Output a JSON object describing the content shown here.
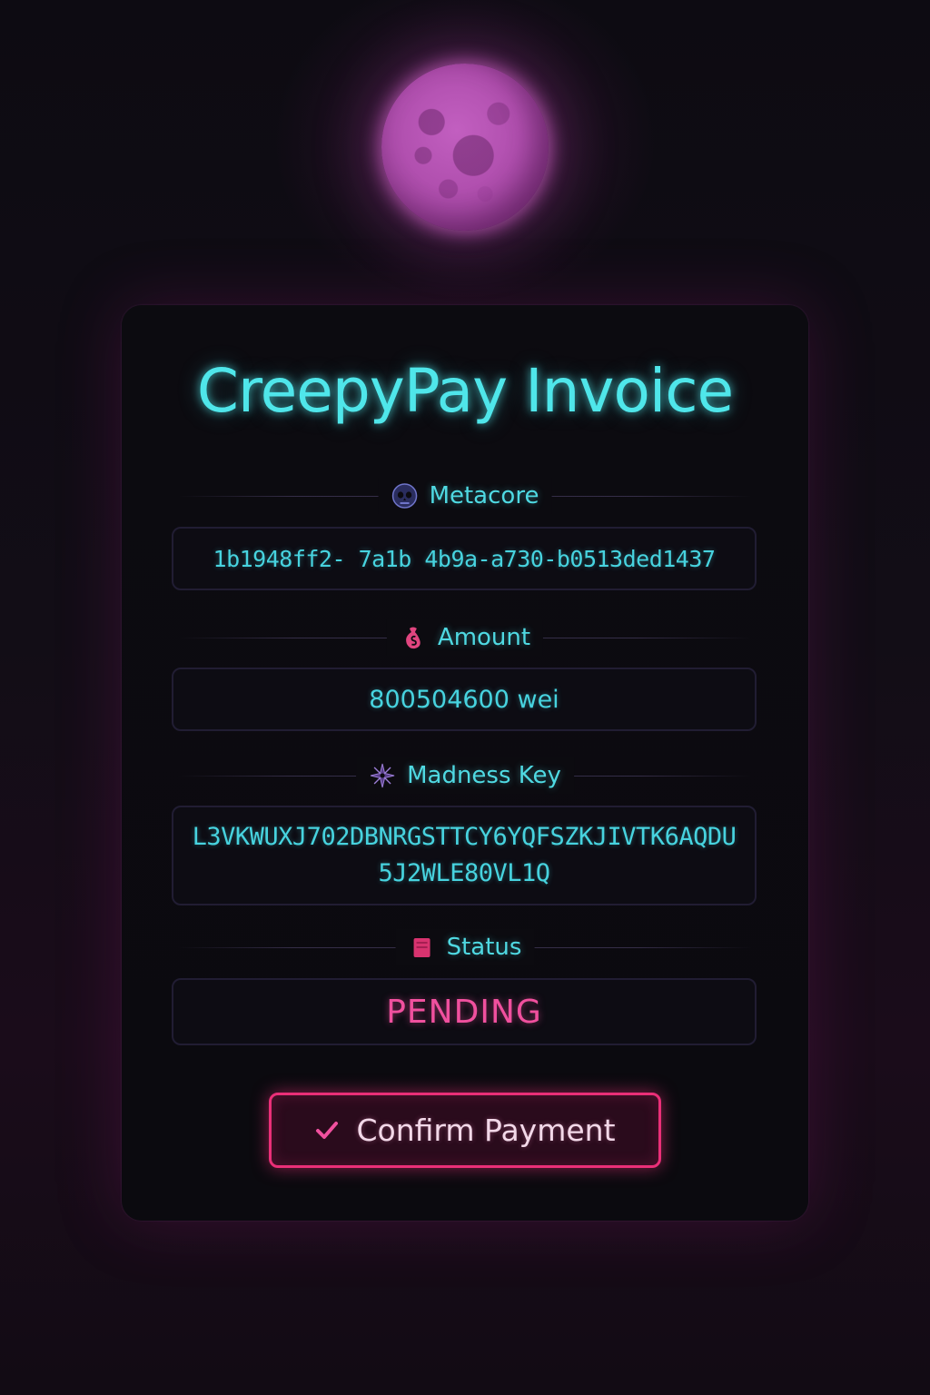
{
  "invoice": {
    "title": "CreepyPay Invoice"
  },
  "fields": {
    "metacore": {
      "label": "Metacore",
      "icon": "skull-icon",
      "value": "1b1948ff2- 7a1b  4b9a-a730-b0513ded1437"
    },
    "amount": {
      "label": "Amount",
      "icon": "money-bag-icon",
      "value": "800504600 wei"
    },
    "madness_key": {
      "label": "Madness Key",
      "icon": "compass-star-icon",
      "value": "L3VKWUXJ702DBNRGSTTCY6YQFSZKJIVTK6AQDU5J2WLE80VL1Q"
    },
    "status": {
      "label": "Status",
      "icon": "status-square-icon",
      "value": "PENDING"
    }
  },
  "actions": {
    "confirm_label": "Confirm Payment",
    "confirm_icon": "checkmark-icon"
  },
  "colors": {
    "cyan_accent": "#4fe6ea",
    "pink_accent": "#ea2f78",
    "status_pending": "#f0509e",
    "moon": "#b04fae",
    "background": "#0d0b12"
  }
}
